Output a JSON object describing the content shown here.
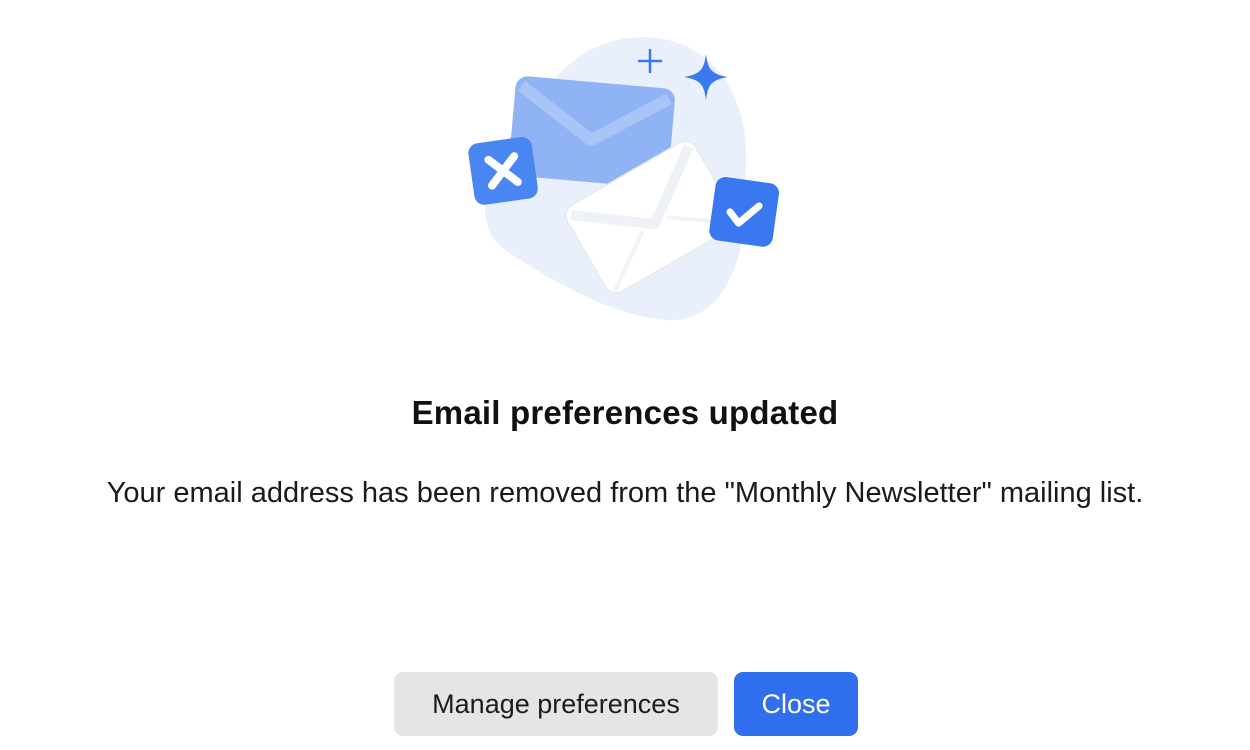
{
  "dialog": {
    "title": "Email preferences updated",
    "message": "Your email address has been removed from the \"Monthly Newsletter\" mailing list.",
    "illustration_icons": [
      "envelope-icon",
      "envelope-icon",
      "close-badge-icon",
      "check-badge-icon",
      "sparkle-icon"
    ]
  },
  "actions": {
    "manage_label": "Manage preferences",
    "close_label": "Close"
  },
  "colors": {
    "primary": "#2f6fee",
    "secondary_bg": "#e5e5e6",
    "blob": "#e9f0fc",
    "envelope_back": "#8fb3f5",
    "badge": "#4a86f2"
  }
}
